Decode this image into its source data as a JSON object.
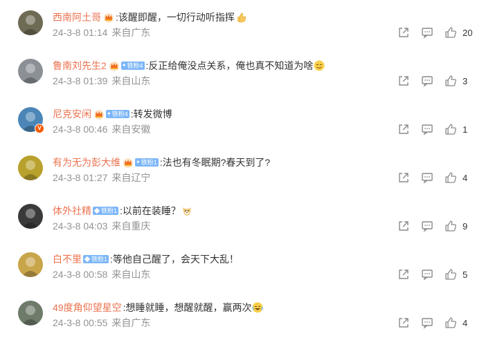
{
  "comments": [
    {
      "name": "西南阿土哥",
      "has_crown": true,
      "fan_badge": "",
      "text": ":该醒即醒，一切行动听指挥",
      "emoji": "thumbs-up-emoji",
      "date": "24-3-8 01:14",
      "source": "来自广东",
      "likes": "20",
      "avatar_color": "#6f6a54"
    },
    {
      "name": "鲁南刘先生2",
      "has_crown": true,
      "fan_badge": "铁粉4",
      "text": ":反正给俺没点关系，俺也真不知道为啥",
      "emoji": "smile-emoji",
      "date": "24-3-8 01:39",
      "source": "来自山东",
      "likes": "3",
      "avatar_color": "#8b8f96"
    },
    {
      "name": "尼克安闲",
      "has_crown": true,
      "fan_badge": "铁粉4",
      "text": ":转发微博",
      "emoji": "",
      "date": "24-3-8 00:46",
      "source": "来自安徽",
      "likes": "1",
      "avatar_color": "#4b86b7"
    },
    {
      "name": "有为无为彭大维",
      "has_crown": true,
      "fan_badge": "铁粉1",
      "text": ":法也有冬眠期?春天到了?",
      "emoji": "",
      "date": "24-3-8 01:27",
      "source": "来自辽宁",
      "likes": "4",
      "avatar_color": "#b8a12c"
    },
    {
      "name": "体外社精",
      "has_crown": false,
      "fan_badge": "铁粉1",
      "text": ":以前在装睡？",
      "emoji": "doge-emoji",
      "date": "24-3-8 04:03",
      "source": "来自重庆",
      "likes": "9",
      "avatar_color": "#3a3a3a"
    },
    {
      "name": "白不里",
      "has_crown": false,
      "fan_badge": "铁粉1",
      "text": ":等他自己醒了，会天下大乱！",
      "emoji": "",
      "date": "24-3-8 00:58",
      "source": "来自山东",
      "likes": "5",
      "avatar_color": "#c9a54a"
    },
    {
      "name": "49度角仰望星空",
      "has_crown": false,
      "fan_badge": "",
      "text": ":想睡就睡，想醒就醒，赢两次",
      "emoji": "laugh-cry-emoji",
      "date": "24-3-8 00:55",
      "source": "来自广东",
      "likes": "4",
      "avatar_color": "#6e7a6a"
    }
  ],
  "colors": {
    "name": "#eb7350",
    "meta": "#939393",
    "icon": "#8a8a8a"
  }
}
